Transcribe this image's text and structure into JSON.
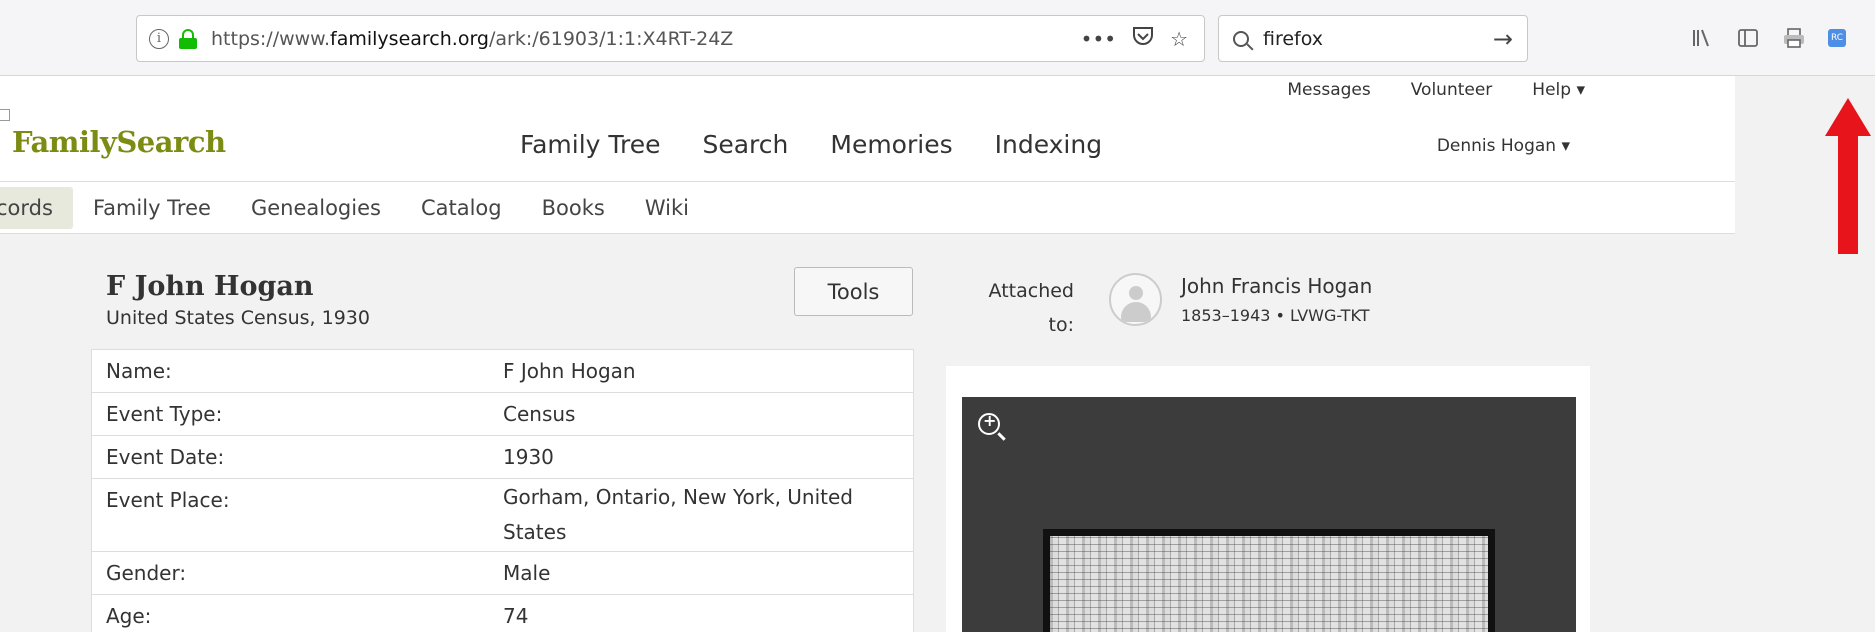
{
  "browser": {
    "url_prefix": "https://www.",
    "url_domain": "familysearch.org",
    "url_path": "/ark:/61903/1:1:X4RT-24Z",
    "more_label": "•••",
    "search_value": "firefox",
    "search_go": "→"
  },
  "header": {
    "util_links": [
      "Messages",
      "Volunteer",
      "Help ▾"
    ],
    "logo": "FamilySearch",
    "main_nav": [
      "Family Tree",
      "Search",
      "Memories",
      "Indexing"
    ],
    "user": "Dennis Hogan ▾"
  },
  "sub_nav": [
    "cords",
    "Family Tree",
    "Genealogies",
    "Catalog",
    "Books",
    "Wiki"
  ],
  "record": {
    "title": "F John Hogan",
    "collection": "United States Census, 1930",
    "tools_label": "Tools",
    "attached_label_1": "Attached",
    "attached_label_2": "to:",
    "person_name": "John Francis Hogan",
    "person_meta": "1853–1943 • LVWG-TKT",
    "rows": [
      {
        "label": "Name:",
        "value": "F John Hogan"
      },
      {
        "label": "Event Type:",
        "value": "Census"
      },
      {
        "label": "Event Date:",
        "value": "1930"
      },
      {
        "label": "Event Place:",
        "value": "Gorham, Ontario, New York, United States"
      },
      {
        "label": "Gender:",
        "value": "Male"
      },
      {
        "label": "Age:",
        "value": "74"
      }
    ]
  },
  "colors": {
    "logo_green": "#7c8c12",
    "arrow_red": "#e8141c",
    "lock_green": "#12bc00"
  }
}
